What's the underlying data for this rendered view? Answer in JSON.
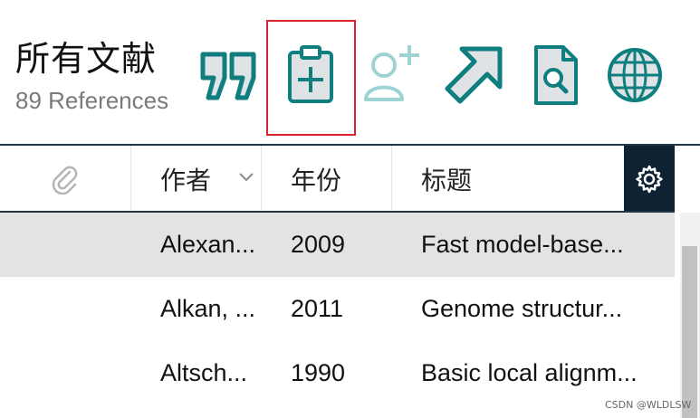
{
  "header": {
    "title": "所有文献",
    "count": "89 References"
  },
  "toolbar": [
    {
      "name": "insert-citation",
      "icon": "quote-icon"
    },
    {
      "name": "add-to-clipboard",
      "icon": "clipboard-plus-icon"
    },
    {
      "name": "share-with-user",
      "icon": "user-plus-icon"
    },
    {
      "name": "export",
      "icon": "arrow-up-right-icon"
    },
    {
      "name": "find-pdf",
      "icon": "document-search-icon"
    },
    {
      "name": "online-search",
      "icon": "globe-icon"
    }
  ],
  "columns": {
    "attachment_icon": "paperclip-icon",
    "author": "作者",
    "year": "年份",
    "title": "标题",
    "sort_icon": "chevron-down-icon",
    "settings_icon": "gear-icon"
  },
  "rows": [
    {
      "author": "Alexan...",
      "year": "2009",
      "title": "Fast model-base...",
      "selected": true
    },
    {
      "author": "Alkan, ...",
      "year": "2011",
      "title": "Genome structur...",
      "selected": false
    },
    {
      "author": "Altsch...",
      "year": "1990",
      "title": "Basic local alignm...",
      "selected": false
    }
  ],
  "watermark": "CSDN @WLDLSW",
  "colors": {
    "icon_teal": "#0e7e7e",
    "icon_fill": "#dfe3e6",
    "icon_disabled": "#9ed3d3",
    "highlight_border": "#d9232d",
    "header_dark": "#0f2233",
    "selected_row": "#e3e3e3"
  }
}
